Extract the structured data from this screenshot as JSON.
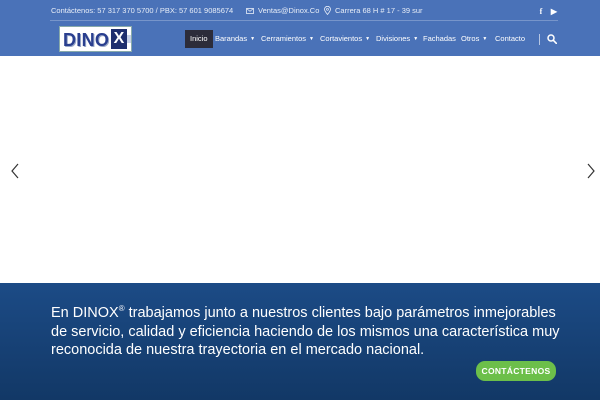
{
  "topbar": {
    "phone": "Contáctenos: 57 317 370 5700 / PBX: 57 601 9085674",
    "email": "Ventas@Dinox.Co",
    "address": "Carrera 68 H # 17 - 39 sur",
    "social": [
      {
        "icon": "facebook-icon",
        "glyph": "f"
      },
      {
        "icon": "youtube-icon",
        "glyph": "▶"
      }
    ]
  },
  "logo": {
    "word": "DINO",
    "x": "X"
  },
  "nav": {
    "items": [
      {
        "label": "Inicio",
        "active": true,
        "dropdown": false
      },
      {
        "label": "Barandas",
        "active": false,
        "dropdown": true
      },
      {
        "label": "Cerramientos",
        "active": false,
        "dropdown": true
      },
      {
        "label": "Cortavientos",
        "active": false,
        "dropdown": true
      },
      {
        "label": "Divisiones",
        "active": false,
        "dropdown": true
      },
      {
        "label": "Fachadas",
        "active": false,
        "dropdown": false
      },
      {
        "label": "Otros",
        "active": false,
        "dropdown": true
      },
      {
        "label": "Contacto",
        "active": false,
        "dropdown": false
      }
    ],
    "caret": "▼"
  },
  "banner": {
    "brand": "En DINOX",
    "reg": "®",
    "text": " trabajamos junto a nuestros clientes bajo parámetros inmejorables de servicio, calidad y eficiencia haciendo de los mismos una característica muy reconocida de nuestra trayectoria en el mercado nacional.",
    "cta": "CONTÁCTENOS"
  },
  "colors": {
    "header": "#4a72b8",
    "banner": "#1c4b86",
    "cta": "#6cbf4a",
    "nav_active": "#2c2c3a"
  }
}
